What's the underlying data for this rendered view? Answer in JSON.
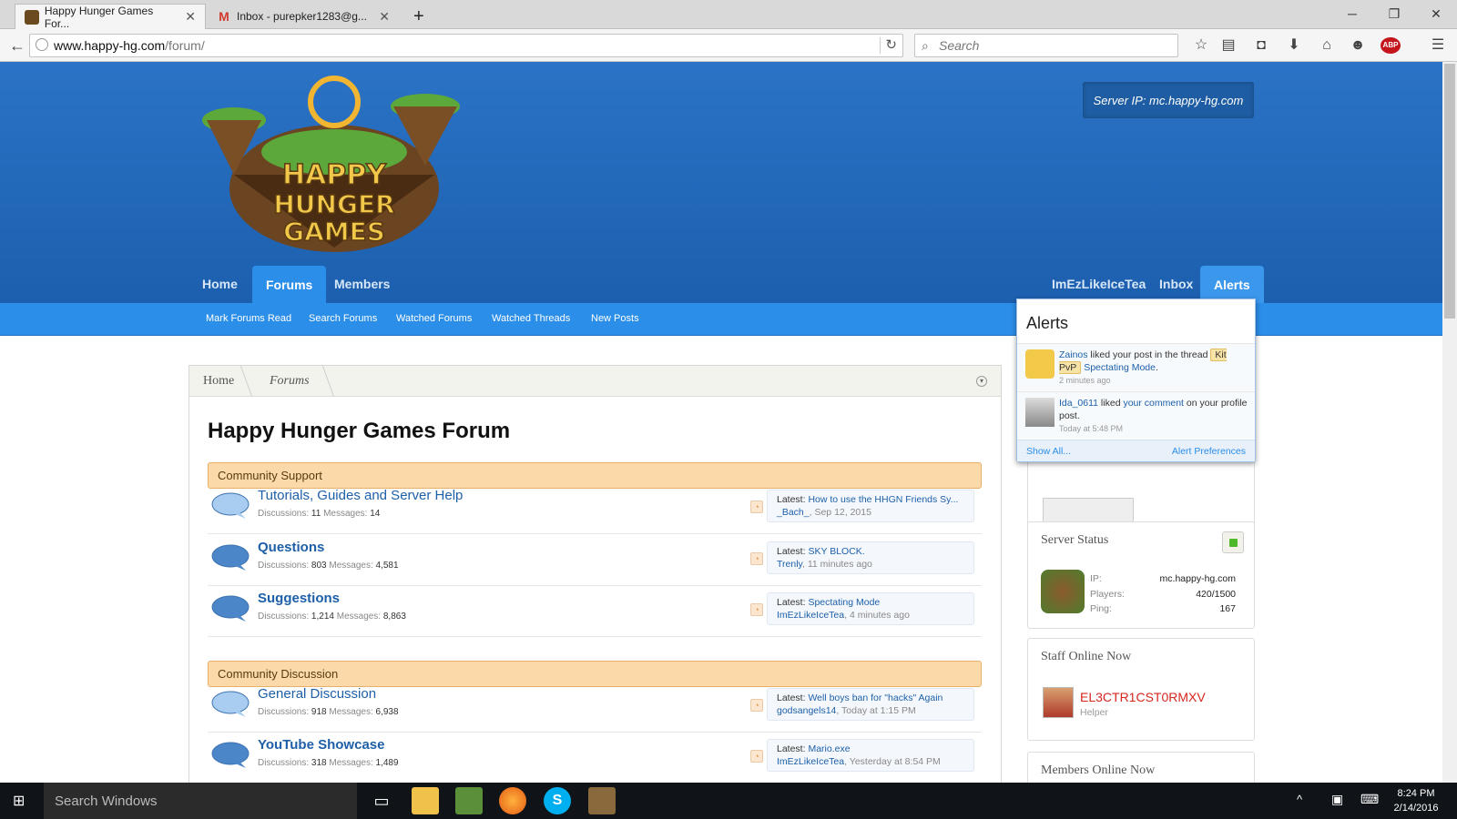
{
  "browser": {
    "tabs": [
      {
        "label": "Happy Hunger Games For..."
      },
      {
        "label": "Inbox - purepker1283@g..."
      }
    ],
    "url_domain": "www.happy-hg.com",
    "url_path": "/forum/",
    "search_placeholder": "Search"
  },
  "header": {
    "server_ip": "Server IP: mc.happy-hg.com",
    "nav_left": [
      "Home",
      "Forums",
      "Members"
    ],
    "nav_right": [
      "ImEzLikeIceTea",
      "Inbox",
      "Alerts"
    ],
    "subnav": [
      "Mark Forums Read",
      "Search Forums",
      "Watched Forums",
      "Watched Threads",
      "New Posts"
    ]
  },
  "breadcrumb": [
    "Home",
    "Forums"
  ],
  "page_title": "Happy Hunger Games Forum",
  "categories": [
    {
      "title": "Community Support",
      "nodes": [
        {
          "title": "Tutorials, Guides and Server Help",
          "discussions": "11",
          "messages": "14",
          "latest_title": "How to use the HHGN Friends Sy...",
          "latest_user": "_Bach_",
          "latest_time": "Sep 12, 2015",
          "unread": false
        },
        {
          "title": "Questions",
          "discussions": "803",
          "messages": "4,581",
          "latest_title": "SKY BLOCK.",
          "latest_user": "Trenly",
          "latest_time": "11 minutes ago",
          "unread": true
        },
        {
          "title": "Suggestions",
          "discussions": "1,214",
          "messages": "8,863",
          "latest_title": "Spectating Mode",
          "latest_user": "ImEzLikeIceTea",
          "latest_time": "4 minutes ago",
          "unread": true
        }
      ]
    },
    {
      "title": "Community Discussion",
      "nodes": [
        {
          "title": "General Discussion",
          "discussions": "918",
          "messages": "6,938",
          "latest_title": "Well boys ban for \"hacks\" Again",
          "latest_user": "godsangels14",
          "latest_time": "Today at 1:15 PM",
          "unread": false
        },
        {
          "title": "YouTube Showcase",
          "discussions": "318",
          "messages": "1,489",
          "latest_title": "Mario.exe",
          "latest_user": "ImEzLikeIceTea",
          "latest_time": "Yesterday at 8:54 PM",
          "unread": true
        }
      ]
    }
  ],
  "labels": {
    "discussions": "Discussions:",
    "messages": "Messages:",
    "latest": "Latest:"
  },
  "alerts": {
    "title": "Alerts",
    "items": [
      {
        "user": "Zainos",
        "text1": " liked your post in the thread ",
        "prefix": "Kit PvP",
        "thread": "Spectating Mode",
        "end": ".",
        "time": "2 minutes ago"
      },
      {
        "user": "Ida_0611",
        "text1": " liked ",
        "link": "your comment",
        "text2": " on your profile post.",
        "time": "Today at 5:48 PM"
      }
    ],
    "show_all": "Show All...",
    "preferences": "Alert Preferences"
  },
  "server_status": {
    "title": "Server Status",
    "ip_label": "IP:",
    "ip": "mc.happy-hg.com",
    "players_label": "Players:",
    "players": "420/1500",
    "ping_label": "Ping:",
    "ping": "167",
    "online_color": "#4cb82a"
  },
  "staff": {
    "title": "Staff Online Now",
    "name": "EL3CTR1CST0RMXV",
    "role": "Helper"
  },
  "members_online_partial": "Members Online Now",
  "taskbar": {
    "search": "Search Windows",
    "time": "8:24 PM",
    "date": "2/14/2016"
  },
  "colors": {
    "header_blue": "#1c5fae",
    "nav_blue": "#2b8ee8",
    "category_bg": "#fbd9a9",
    "link": "#1d5fa8"
  }
}
